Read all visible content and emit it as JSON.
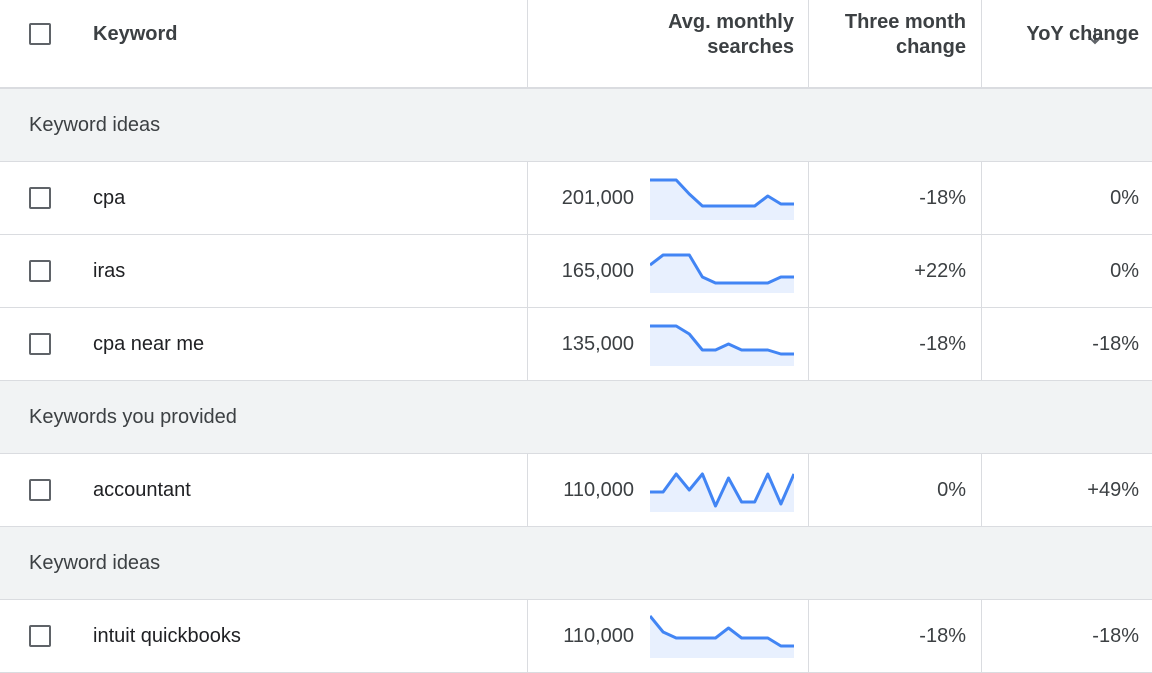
{
  "colors": {
    "accent": "#4285f4",
    "spark_fill": "#e8f0fe",
    "group_bg": "#f1f3f4",
    "divider": "#dadce0"
  },
  "header": {
    "keyword": "Keyword",
    "avg_line1": "Avg. monthly",
    "avg_line2": "searches",
    "three_line1": "Three month",
    "three_line2": "change",
    "yoy": "YoY change",
    "sort_icon": "arrow-down-icon"
  },
  "sections": [
    {
      "group": "Keyword ideas",
      "rows": [
        {
          "keyword": "cpa",
          "avg": "201,000",
          "three": "-18%",
          "yoy": "0%",
          "trend": [
            95,
            95,
            95,
            60,
            30,
            30,
            30,
            30,
            30,
            55,
            35,
            35
          ]
        },
        {
          "keyword": "iras",
          "avg": "165,000",
          "three": "+22%",
          "yoy": "0%",
          "trend": [
            65,
            90,
            90,
            90,
            35,
            20,
            20,
            20,
            20,
            20,
            35,
            35
          ]
        },
        {
          "keyword": "cpa near me",
          "avg": "135,000",
          "three": "-18%",
          "yoy": "-18%",
          "trend": [
            95,
            95,
            95,
            75,
            35,
            35,
            50,
            35,
            35,
            35,
            25,
            25
          ]
        }
      ]
    },
    {
      "group": "Keywords you provided",
      "rows": [
        {
          "keyword": "accountant",
          "avg": "110,000",
          "three": "0%",
          "yoy": "+49%",
          "trend": [
            45,
            45,
            90,
            50,
            90,
            10,
            80,
            20,
            20,
            90,
            15,
            90
          ]
        }
      ]
    },
    {
      "group": "Keyword ideas",
      "rows": [
        {
          "keyword": "intuit quickbooks",
          "avg": "110,000",
          "three": "-18%",
          "yoy": "-18%",
          "trend": [
            100,
            60,
            45,
            45,
            45,
            45,
            70,
            45,
            45,
            45,
            25,
            25
          ]
        }
      ]
    }
  ]
}
